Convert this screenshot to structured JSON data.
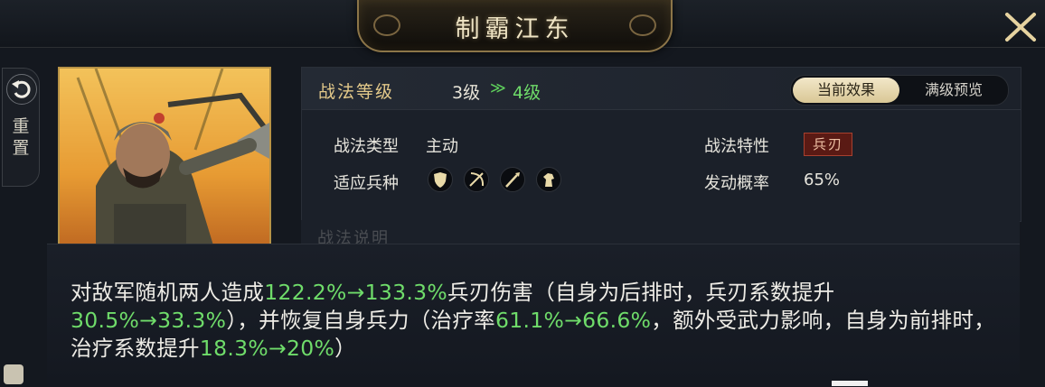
{
  "header": {
    "title": "制霸江东"
  },
  "side": {
    "reset_label": "重\n置"
  },
  "level": {
    "label": "战法等级",
    "current": "3级",
    "arrow": "≫",
    "next": "4级"
  },
  "tabs": {
    "current": "当前效果",
    "max": "满级预览"
  },
  "info": {
    "type_label": "战法类型",
    "type_value": "主动",
    "trait_label": "战法特性",
    "trait_value": "兵刃",
    "troops_label": "适应兵种",
    "troops": [
      "shield-icon",
      "bow-icon",
      "spear-icon",
      "horse-icon"
    ],
    "chance_label": "发动概率",
    "chance_value": "65%"
  },
  "description": {
    "header_partial": "战法说明",
    "p1": "对敌军随机两人造成",
    "v1": "122.2%→133.3%",
    "p2": "兵刃伤害（自身为后排时，兵刃系数提升",
    "v2": "30.5%→33.3%",
    "p3": "），并恢复自身兵力（治疗率",
    "v3": "61.1%→66.6%",
    "p4": "，额外受武力影响，自身为前排时，治疗系数提升",
    "v4": "18.3%→20%",
    "p5": "）"
  },
  "colors": {
    "accent_gold": "#e3c98a",
    "highlight_green": "#6fdc6a",
    "trait_red": "#5a1a14"
  }
}
